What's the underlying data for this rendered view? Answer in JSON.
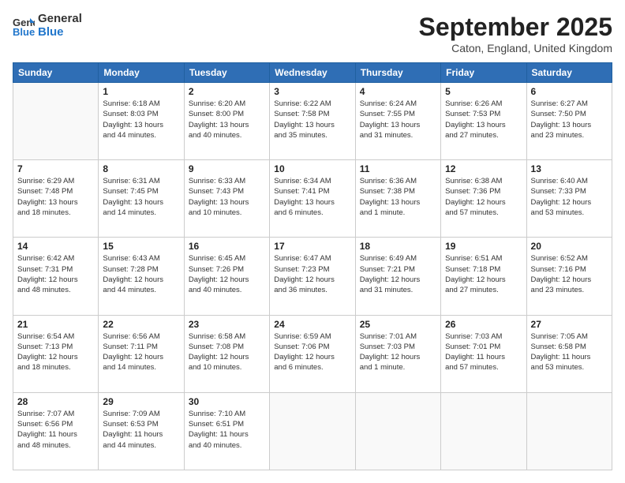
{
  "header": {
    "logo": {
      "line1": "General",
      "line2": "Blue"
    },
    "title": "September 2025",
    "subtitle": "Caton, England, United Kingdom"
  },
  "weekdays": [
    "Sunday",
    "Monday",
    "Tuesday",
    "Wednesday",
    "Thursday",
    "Friday",
    "Saturday"
  ],
  "weeks": [
    [
      {
        "day": "",
        "detail": ""
      },
      {
        "day": "1",
        "detail": "Sunrise: 6:18 AM\nSunset: 8:03 PM\nDaylight: 13 hours\nand 44 minutes."
      },
      {
        "day": "2",
        "detail": "Sunrise: 6:20 AM\nSunset: 8:00 PM\nDaylight: 13 hours\nand 40 minutes."
      },
      {
        "day": "3",
        "detail": "Sunrise: 6:22 AM\nSunset: 7:58 PM\nDaylight: 13 hours\nand 35 minutes."
      },
      {
        "day": "4",
        "detail": "Sunrise: 6:24 AM\nSunset: 7:55 PM\nDaylight: 13 hours\nand 31 minutes."
      },
      {
        "day": "5",
        "detail": "Sunrise: 6:26 AM\nSunset: 7:53 PM\nDaylight: 13 hours\nand 27 minutes."
      },
      {
        "day": "6",
        "detail": "Sunrise: 6:27 AM\nSunset: 7:50 PM\nDaylight: 13 hours\nand 23 minutes."
      }
    ],
    [
      {
        "day": "7",
        "detail": "Sunrise: 6:29 AM\nSunset: 7:48 PM\nDaylight: 13 hours\nand 18 minutes."
      },
      {
        "day": "8",
        "detail": "Sunrise: 6:31 AM\nSunset: 7:45 PM\nDaylight: 13 hours\nand 14 minutes."
      },
      {
        "day": "9",
        "detail": "Sunrise: 6:33 AM\nSunset: 7:43 PM\nDaylight: 13 hours\nand 10 minutes."
      },
      {
        "day": "10",
        "detail": "Sunrise: 6:34 AM\nSunset: 7:41 PM\nDaylight: 13 hours\nand 6 minutes."
      },
      {
        "day": "11",
        "detail": "Sunrise: 6:36 AM\nSunset: 7:38 PM\nDaylight: 13 hours\nand 1 minute."
      },
      {
        "day": "12",
        "detail": "Sunrise: 6:38 AM\nSunset: 7:36 PM\nDaylight: 12 hours\nand 57 minutes."
      },
      {
        "day": "13",
        "detail": "Sunrise: 6:40 AM\nSunset: 7:33 PM\nDaylight: 12 hours\nand 53 minutes."
      }
    ],
    [
      {
        "day": "14",
        "detail": "Sunrise: 6:42 AM\nSunset: 7:31 PM\nDaylight: 12 hours\nand 48 minutes."
      },
      {
        "day": "15",
        "detail": "Sunrise: 6:43 AM\nSunset: 7:28 PM\nDaylight: 12 hours\nand 44 minutes."
      },
      {
        "day": "16",
        "detail": "Sunrise: 6:45 AM\nSunset: 7:26 PM\nDaylight: 12 hours\nand 40 minutes."
      },
      {
        "day": "17",
        "detail": "Sunrise: 6:47 AM\nSunset: 7:23 PM\nDaylight: 12 hours\nand 36 minutes."
      },
      {
        "day": "18",
        "detail": "Sunrise: 6:49 AM\nSunset: 7:21 PM\nDaylight: 12 hours\nand 31 minutes."
      },
      {
        "day": "19",
        "detail": "Sunrise: 6:51 AM\nSunset: 7:18 PM\nDaylight: 12 hours\nand 27 minutes."
      },
      {
        "day": "20",
        "detail": "Sunrise: 6:52 AM\nSunset: 7:16 PM\nDaylight: 12 hours\nand 23 minutes."
      }
    ],
    [
      {
        "day": "21",
        "detail": "Sunrise: 6:54 AM\nSunset: 7:13 PM\nDaylight: 12 hours\nand 18 minutes."
      },
      {
        "day": "22",
        "detail": "Sunrise: 6:56 AM\nSunset: 7:11 PM\nDaylight: 12 hours\nand 14 minutes."
      },
      {
        "day": "23",
        "detail": "Sunrise: 6:58 AM\nSunset: 7:08 PM\nDaylight: 12 hours\nand 10 minutes."
      },
      {
        "day": "24",
        "detail": "Sunrise: 6:59 AM\nSunset: 7:06 PM\nDaylight: 12 hours\nand 6 minutes."
      },
      {
        "day": "25",
        "detail": "Sunrise: 7:01 AM\nSunset: 7:03 PM\nDaylight: 12 hours\nand 1 minute."
      },
      {
        "day": "26",
        "detail": "Sunrise: 7:03 AM\nSunset: 7:01 PM\nDaylight: 11 hours\nand 57 minutes."
      },
      {
        "day": "27",
        "detail": "Sunrise: 7:05 AM\nSunset: 6:58 PM\nDaylight: 11 hours\nand 53 minutes."
      }
    ],
    [
      {
        "day": "28",
        "detail": "Sunrise: 7:07 AM\nSunset: 6:56 PM\nDaylight: 11 hours\nand 48 minutes."
      },
      {
        "day": "29",
        "detail": "Sunrise: 7:09 AM\nSunset: 6:53 PM\nDaylight: 11 hours\nand 44 minutes."
      },
      {
        "day": "30",
        "detail": "Sunrise: 7:10 AM\nSunset: 6:51 PM\nDaylight: 11 hours\nand 40 minutes."
      },
      {
        "day": "",
        "detail": ""
      },
      {
        "day": "",
        "detail": ""
      },
      {
        "day": "",
        "detail": ""
      },
      {
        "day": "",
        "detail": ""
      }
    ]
  ]
}
